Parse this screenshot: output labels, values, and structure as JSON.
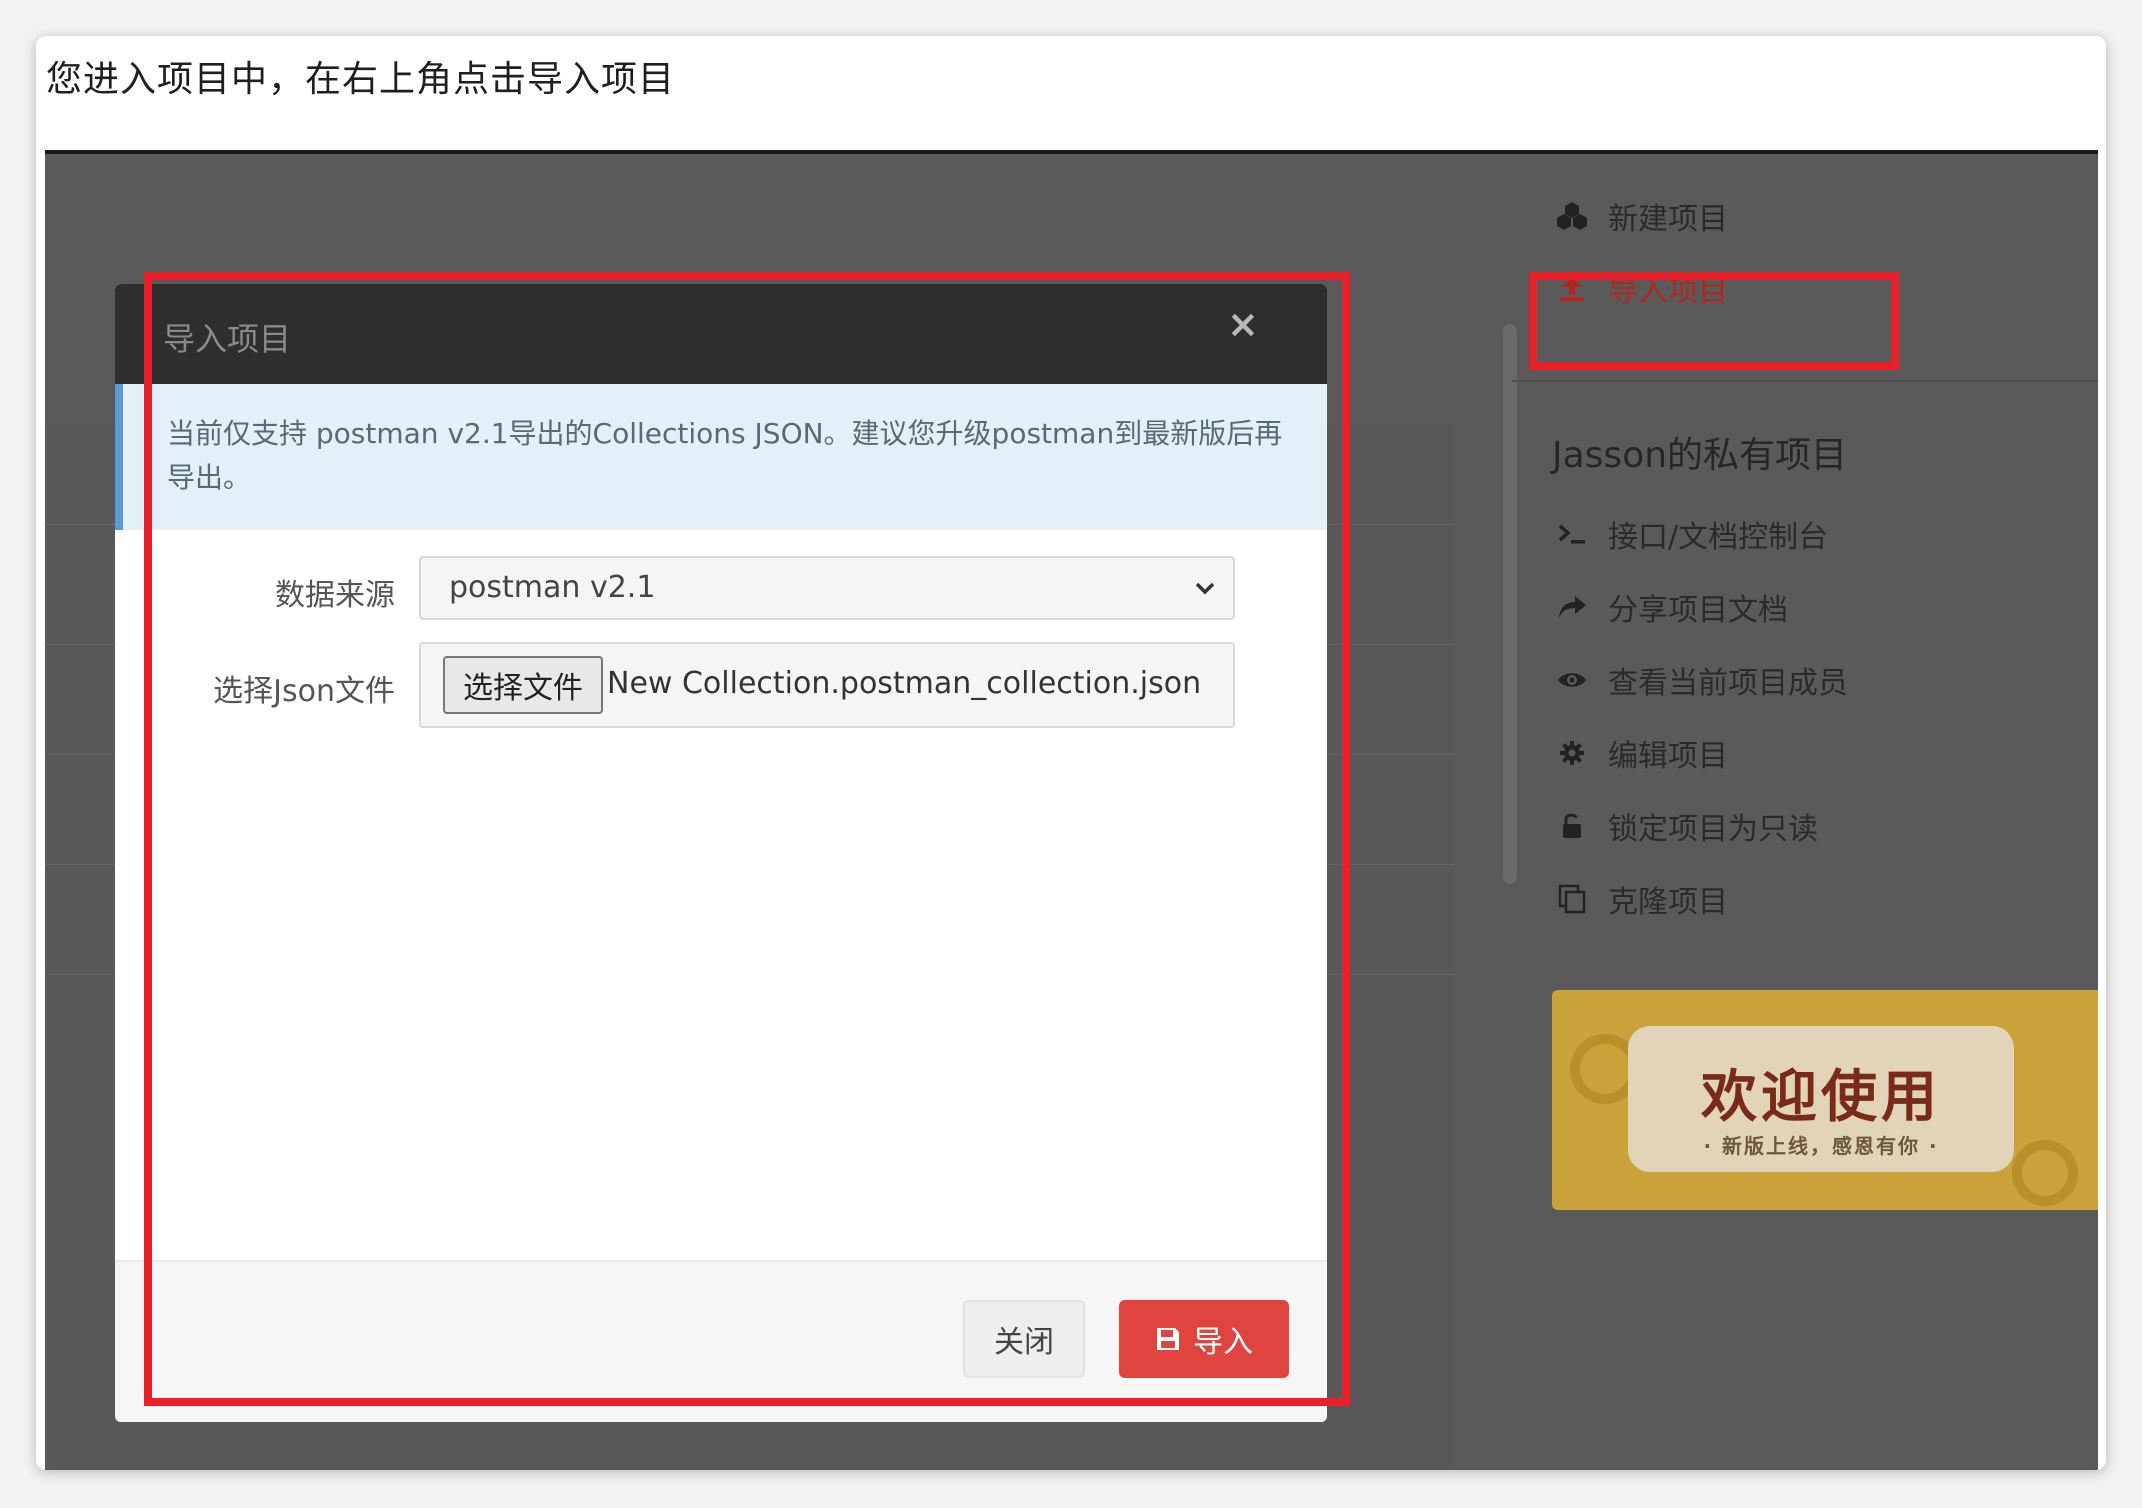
{
  "instruction": "您进入项目中，在右上角点击导入项目",
  "modal": {
    "title": "导入项目",
    "close_symbol": "×",
    "alert": "当前仅支持 postman v2.1导出的Collections JSON。建议您升级postman到最新版后再导出。",
    "source_label": "数据来源",
    "source_value": "postman v2.1",
    "file_label": "选择Json文件",
    "file_button": "选择文件",
    "file_name": "New Collection.postman_collection.json",
    "cancel_label": "关闭",
    "import_label": "导入"
  },
  "sidebar": {
    "new_project": "新建项目",
    "import_project": "导入项目",
    "section_title": "Jasson的私有项目",
    "items": [
      {
        "label": "接口/文档控制台",
        "icon": "terminal-icon"
      },
      {
        "label": "分享项目文档",
        "icon": "share-icon"
      },
      {
        "label": "查看当前项目成员",
        "icon": "eye-icon"
      },
      {
        "label": "编辑项目",
        "icon": "gear-icon"
      },
      {
        "label": "锁定项目为只读",
        "icon": "unlock-icon"
      },
      {
        "label": "克隆项目",
        "icon": "copy-icon"
      }
    ]
  },
  "banner": {
    "title": "欢迎使用",
    "subtitle": "· 新版上线，感恩有你 ·"
  },
  "colors": {
    "annotation": "#e8202a",
    "primary_button": "#e0443e",
    "active_link": "#b3261e"
  }
}
